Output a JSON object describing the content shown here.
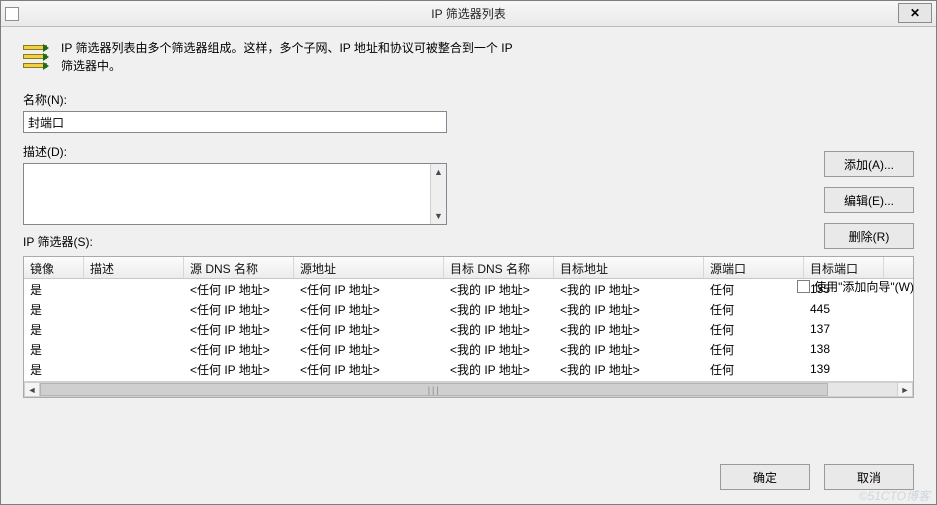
{
  "window": {
    "title": "IP 筛选器列表",
    "close_label": "✕"
  },
  "intro": {
    "line1": "IP 筛选器列表由多个筛选器组成。这样，多个子网、IP 地址和协议可被整合到一个 IP",
    "line2": "筛选器中。"
  },
  "labels": {
    "name": "名称(N):",
    "description": "描述(D):",
    "filters": "IP 筛选器(S):",
    "use_wizard": "使用\"添加向导\"(W)"
  },
  "fields": {
    "name_value": "封端口",
    "description_value": ""
  },
  "buttons": {
    "add": "添加(A)...",
    "edit": "编辑(E)...",
    "remove": "删除(R)",
    "ok": "确定",
    "cancel": "取消"
  },
  "wizard_checked": false,
  "table": {
    "columns": [
      "镜像",
      "描述",
      "源 DNS 名称",
      "源地址",
      "目标 DNS 名称",
      "目标地址",
      "源端口",
      "目标端口"
    ],
    "rows": [
      {
        "mirror": "是",
        "desc": "",
        "src_dns": "<任何 IP 地址>",
        "src": "<任何 IP 地址>",
        "dst_dns": "<我的 IP 地址>",
        "dst": "<我的 IP 地址>",
        "sport": "任何",
        "dport": "135"
      },
      {
        "mirror": "是",
        "desc": "",
        "src_dns": "<任何 IP 地址>",
        "src": "<任何 IP 地址>",
        "dst_dns": "<我的 IP 地址>",
        "dst": "<我的 IP 地址>",
        "sport": "任何",
        "dport": "445"
      },
      {
        "mirror": "是",
        "desc": "",
        "src_dns": "<任何 IP 地址>",
        "src": "<任何 IP 地址>",
        "dst_dns": "<我的 IP 地址>",
        "dst": "<我的 IP 地址>",
        "sport": "任何",
        "dport": "137"
      },
      {
        "mirror": "是",
        "desc": "",
        "src_dns": "<任何 IP 地址>",
        "src": "<任何 IP 地址>",
        "dst_dns": "<我的 IP 地址>",
        "dst": "<我的 IP 地址>",
        "sport": "任何",
        "dport": "138"
      },
      {
        "mirror": "是",
        "desc": "",
        "src_dns": "<任何 IP 地址>",
        "src": "<任何 IP 地址>",
        "dst_dns": "<我的 IP 地址>",
        "dst": "<我的 IP 地址>",
        "sport": "任何",
        "dport": "139"
      }
    ]
  },
  "watermark": "©51CTO博客"
}
